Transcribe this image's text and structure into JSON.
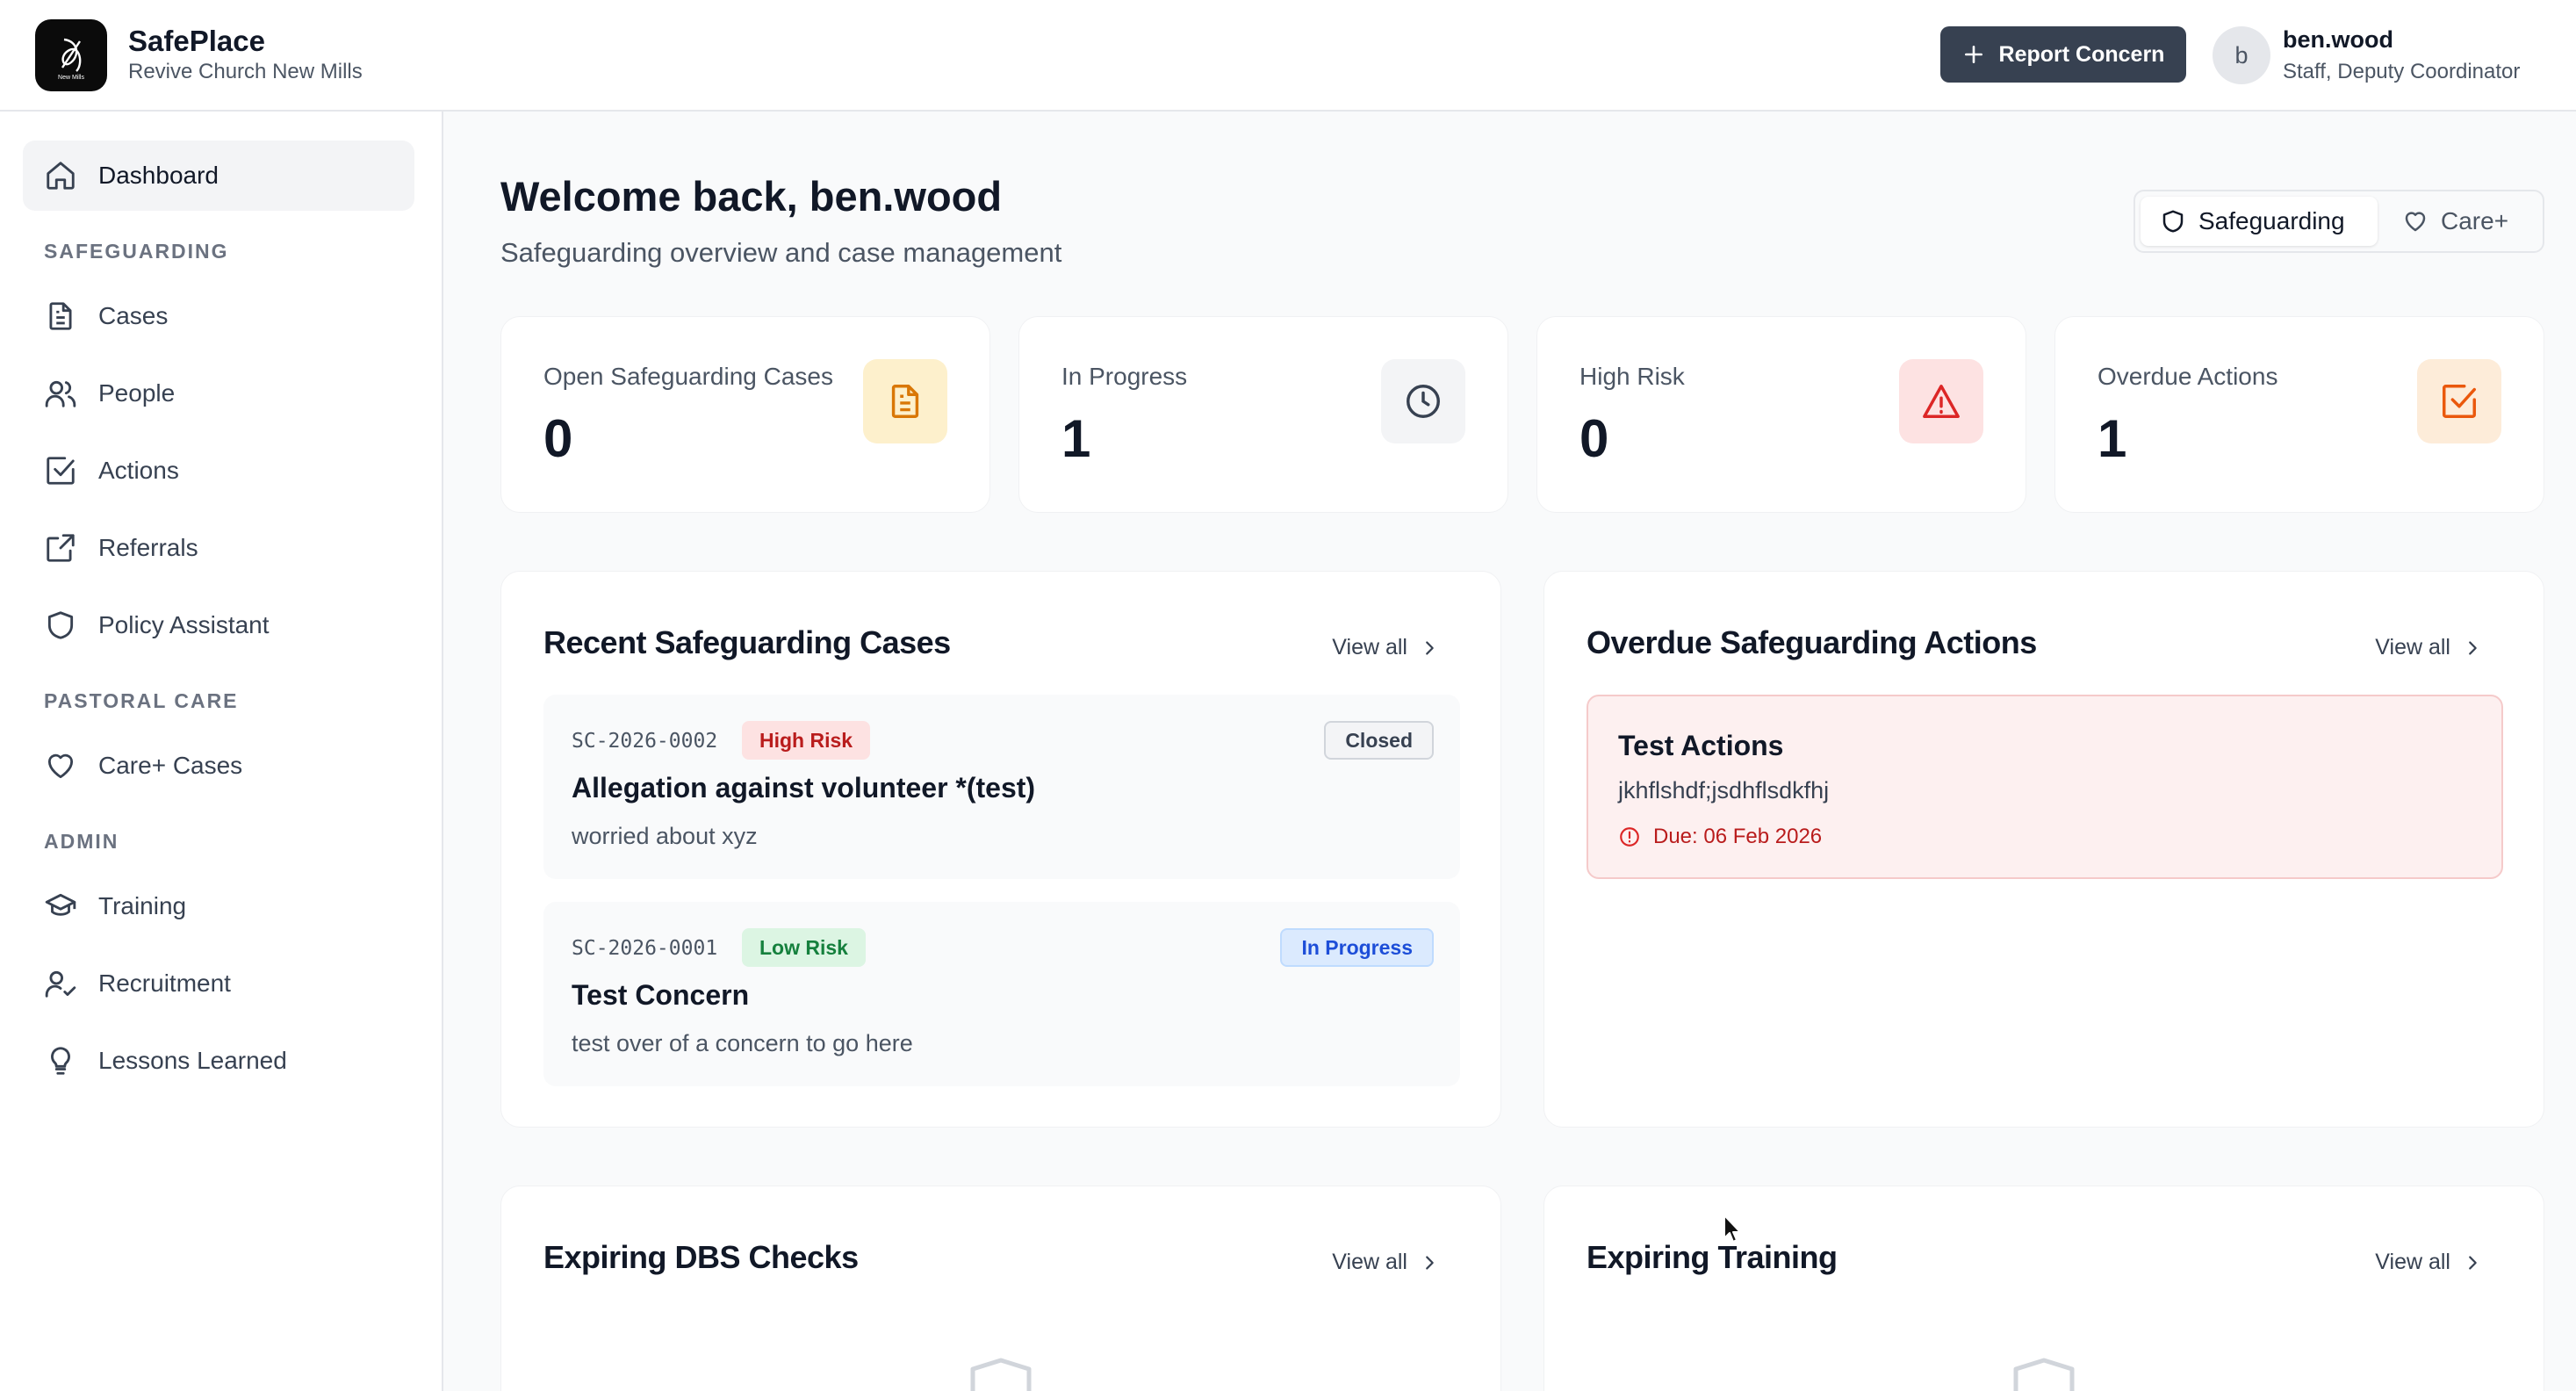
{
  "brand": {
    "name": "SafePlace",
    "subtitle": "Revive Church New Mills",
    "logo_text": "New Mills"
  },
  "header": {
    "report_button_label": "Report Concern",
    "user": {
      "avatar_initial": "b",
      "name": "ben.wood",
      "role": "Staff, Deputy Coordinator"
    }
  },
  "sidebar": {
    "dashboard": "Dashboard",
    "sections": {
      "safeguarding": "SAFEGUARDING",
      "pastoral": "PASTORAL CARE",
      "admin": "ADMIN"
    },
    "safeguarding_items": [
      "Cases",
      "People",
      "Actions",
      "Referrals",
      "Policy Assistant"
    ],
    "pastoral_items": [
      "Care+ Cases"
    ],
    "admin_items": [
      "Training",
      "Recruitment",
      "Lessons Learned"
    ]
  },
  "page": {
    "welcome": "Welcome back, ben.wood",
    "subtitle": "Safeguarding overview and case management",
    "modes": [
      "Safeguarding",
      "Care+"
    ]
  },
  "stats": [
    {
      "label": "Open Safeguarding Cases",
      "value": "0",
      "icon": "document-icon",
      "icon_bg": "#fdf0cc",
      "icon_color": "#d97706"
    },
    {
      "label": "In Progress",
      "value": "1",
      "icon": "clock-icon",
      "icon_bg": "#f3f4f6",
      "icon_color": "#374151"
    },
    {
      "label": "High Risk",
      "value": "0",
      "icon": "warning-icon",
      "icon_bg": "#fde2e2",
      "icon_color": "#dc2626"
    },
    {
      "label": "Overdue Actions",
      "value": "1",
      "icon": "checkbox-icon",
      "icon_bg": "#fdecd9",
      "icon_color": "#ea580c"
    }
  ],
  "recent_cases": {
    "title": "Recent Safeguarding Cases",
    "view_all": "View all",
    "items": [
      {
        "ref": "SC-2026-0002",
        "risk": "High Risk",
        "status": "Closed",
        "title": "Allegation against volunteer *(test)",
        "description": "worried about xyz"
      },
      {
        "ref": "SC-2026-0001",
        "risk": "Low Risk",
        "status": "In Progress",
        "title": "Test Concern",
        "description": "test over of a concern to go here"
      }
    ]
  },
  "overdue_actions": {
    "title": "Overdue Safeguarding Actions",
    "view_all": "View all",
    "items": [
      {
        "title": "Test Actions",
        "description": "jkhflshdf;jsdhflsdkfhj",
        "due": "Due: 06 Feb 2026"
      }
    ]
  },
  "expiring_dbs": {
    "title": "Expiring DBS Checks",
    "view_all": "View all"
  },
  "expiring_training": {
    "title": "Expiring Training",
    "view_all": "View all"
  }
}
